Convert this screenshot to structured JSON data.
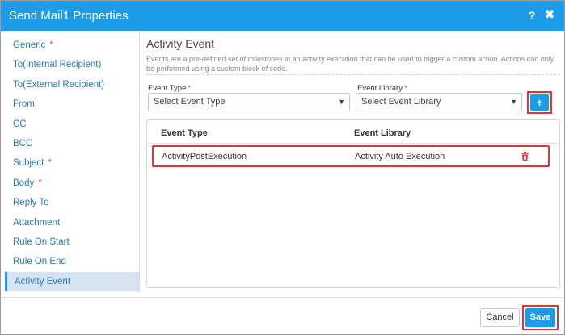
{
  "window": {
    "title": "Send Mail1 Properties",
    "help_label": "?",
    "close_label": "✖"
  },
  "sidebar": {
    "items": [
      {
        "label": "Generic",
        "required": "*"
      },
      {
        "label": "To(Internal Recipient)",
        "required": ""
      },
      {
        "label": "To(External Recipient)",
        "required": ""
      },
      {
        "label": "From",
        "required": ""
      },
      {
        "label": "CC",
        "required": ""
      },
      {
        "label": "BCC",
        "required": ""
      },
      {
        "label": "Subject",
        "required": "*"
      },
      {
        "label": "Body",
        "required": "*"
      },
      {
        "label": "Reply To",
        "required": ""
      },
      {
        "label": "Attachment",
        "required": ""
      },
      {
        "label": "Rule On Start",
        "required": ""
      },
      {
        "label": "Rule On End",
        "required": ""
      },
      {
        "label": "Activity Event",
        "required": ""
      }
    ],
    "active": "Activity Event"
  },
  "main": {
    "title": "Activity Event",
    "description": "Events are a pre-defined set of milestones in an activity execution that can be used to trigger a custom action. Actions can only be performed using a custom block of code.",
    "event_type": {
      "label": "Event Type",
      "required": "*",
      "value": "Select Event Type"
    },
    "event_library": {
      "label": "Event Library",
      "required": "*",
      "value": "Select Event Library"
    },
    "add_label": "+",
    "table": {
      "headers": [
        "Event Type",
        "Event Library"
      ],
      "rows": [
        {
          "event_type": "ActivityPostExecution",
          "event_library": "Activity Auto Execution"
        }
      ]
    }
  },
  "footer": {
    "cancel_label": "Cancel",
    "save_label": "Save"
  },
  "colors": {
    "accent": "#1d9be6",
    "highlight": "#d9363e",
    "link": "#2a79b5",
    "required": "#d9534f"
  },
  "icons": {
    "delete": "trash-icon",
    "dropdown": "caret-down-icon"
  }
}
